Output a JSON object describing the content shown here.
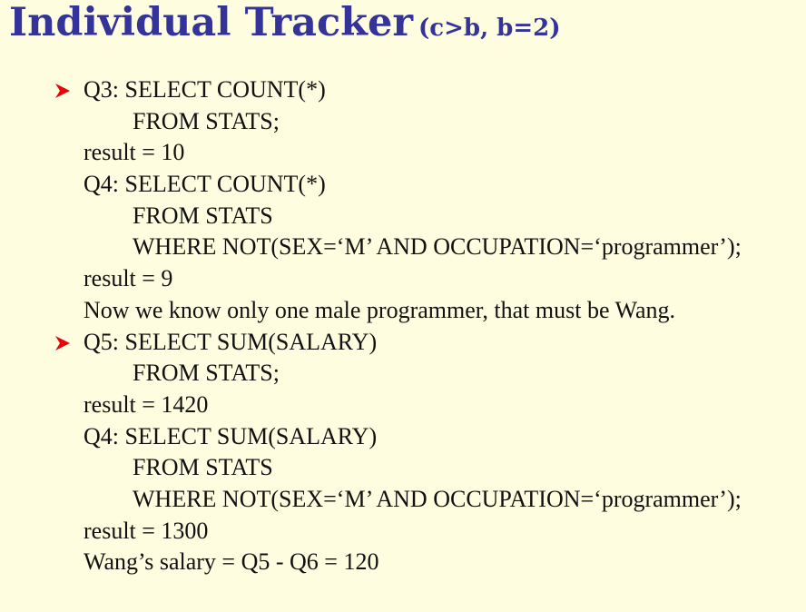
{
  "title": {
    "main": "Individual Tracker",
    "sub": "(c>b, b=2)"
  },
  "lines": [
    {
      "text": "Q3: SELECT COUNT(*)",
      "bullet": true
    },
    {
      "text": "FROM STATS;",
      "indent": true
    },
    {
      "text": "result = 10"
    },
    {
      "text": "Q4: SELECT COUNT(*)"
    },
    {
      "text": "FROM STATS",
      "indent": true
    },
    {
      "text": "WHERE NOT(SEX=‘M’ AND OCCUPATION=‘programmer’);",
      "indent": true
    },
    {
      "text": "result = 9"
    },
    {
      "text": "Now we know only one male programmer, that must be Wang."
    },
    {
      "text": "Q5: SELECT SUM(SALARY)",
      "bullet": true
    },
    {
      "text": "FROM STATS;",
      "indent": true
    },
    {
      "text": "result = 1420"
    },
    {
      "text": "Q4: SELECT SUM(SALARY)"
    },
    {
      "text": "FROM STATS",
      "indent": true
    },
    {
      "text": "WHERE NOT(SEX=‘M’ AND OCCUPATION=‘programmer’);",
      "indent": true
    },
    {
      "text": "result = 1300"
    },
    {
      "text": "Wang’s salary = Q5 - Q6 = 120"
    }
  ],
  "colors": {
    "background": "#FFFDE0",
    "title": "#33339A",
    "bullet": "#E8000B",
    "text": "#111111"
  },
  "icons": {
    "bullet": "arrow-bullet-icon"
  }
}
